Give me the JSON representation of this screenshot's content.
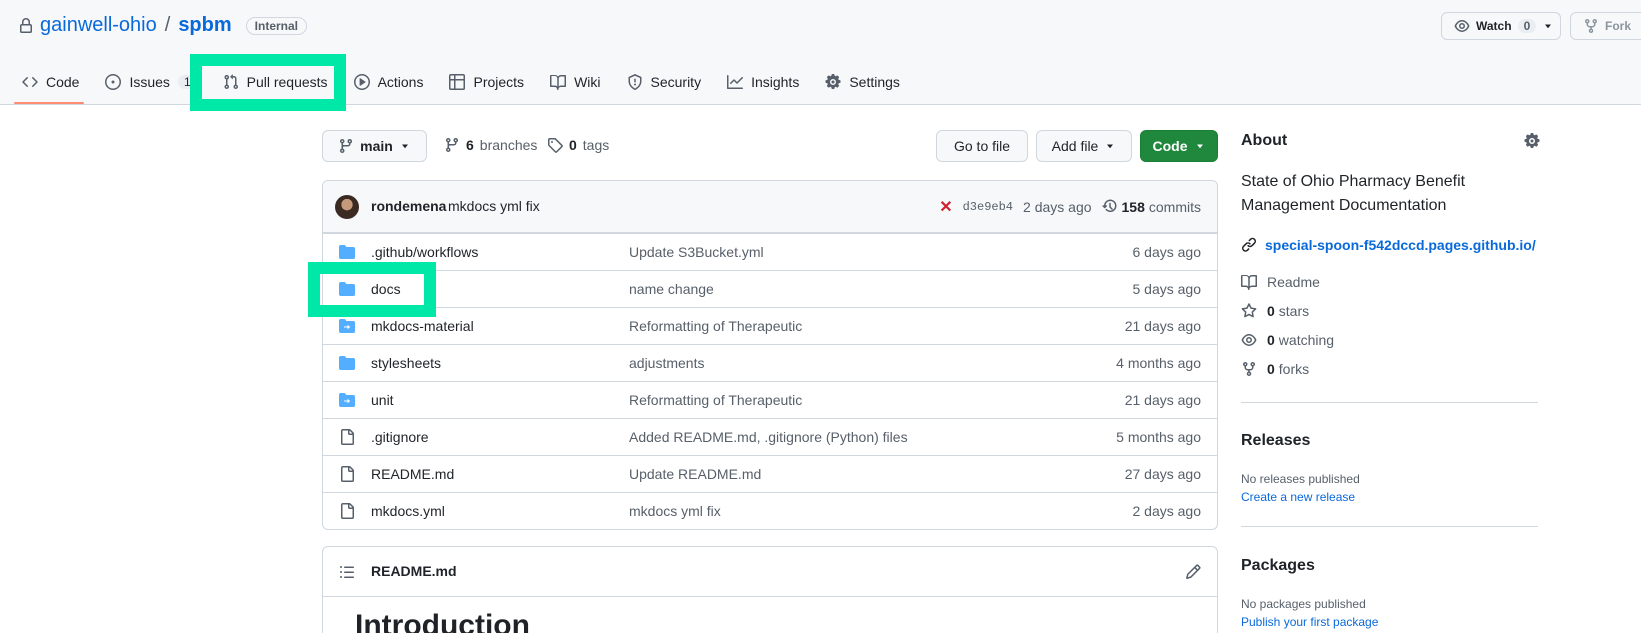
{
  "repo": {
    "owner": "gainwell-ohio",
    "separator": "/",
    "name": "spbm",
    "visibility": "Internal"
  },
  "header_actions": {
    "watch_label": "Watch",
    "watch_count": "0",
    "fork_label": "Fork"
  },
  "tabs": [
    {
      "label": "Code",
      "icon": "code-icon"
    },
    {
      "label": "Issues",
      "icon": "issue-icon",
      "count": "1"
    },
    {
      "label": "Pull requests",
      "icon": "pull-request-icon"
    },
    {
      "label": "Actions",
      "icon": "play-icon"
    },
    {
      "label": "Projects",
      "icon": "table-icon"
    },
    {
      "label": "Wiki",
      "icon": "book-icon"
    },
    {
      "label": "Security",
      "icon": "shield-icon"
    },
    {
      "label": "Insights",
      "icon": "graph-icon"
    },
    {
      "label": "Settings",
      "icon": "gear-icon"
    }
  ],
  "toolbar": {
    "branch": "main",
    "branches_count": "6",
    "branches_label": "branches",
    "tags_count": "0",
    "tags_label": "tags",
    "go_to_file": "Go to file",
    "add_file": "Add file",
    "code": "Code"
  },
  "latest_commit": {
    "author": "rondemena",
    "message": "mkdocs yml fix",
    "sha": "d3e9eb4",
    "age": "2 days ago",
    "commits_count": "158",
    "commits_label": "commits"
  },
  "files": [
    {
      "name": ".github/workflows",
      "type": "folder",
      "message": "Update S3Bucket.yml",
      "age": "6 days ago"
    },
    {
      "name": "docs",
      "type": "folder",
      "message": "name change",
      "age": "5 days ago"
    },
    {
      "name": "mkdocs-material",
      "type": "submodule",
      "message": "Reformatting of Therapeutic",
      "age": "21 days ago"
    },
    {
      "name": "stylesheets",
      "type": "folder",
      "message": "adjustments",
      "age": "4 months ago"
    },
    {
      "name": "unit",
      "type": "submodule",
      "message": "Reformatting of Therapeutic",
      "age": "21 days ago"
    },
    {
      "name": ".gitignore",
      "type": "file",
      "message": "Added README.md, .gitignore (Python) files",
      "age": "5 months ago"
    },
    {
      "name": "README.md",
      "type": "file",
      "message": "Update README.md",
      "age": "27 days ago"
    },
    {
      "name": "mkdocs.yml",
      "type": "file",
      "message": "mkdocs yml fix",
      "age": "2 days ago"
    }
  ],
  "readme": {
    "title": "README.md",
    "heading": "Introduction"
  },
  "about": {
    "heading": "About",
    "description": "State of Ohio Pharmacy Benefit Management Documentation",
    "website": "special-spoon-f542dccd.pages.github.io/",
    "readme_label": "Readme",
    "stars_count": "0",
    "stars_label": "stars",
    "watching_count": "0",
    "watching_label": "watching",
    "forks_count": "0",
    "forks_label": "forks"
  },
  "releases": {
    "heading": "Releases",
    "empty_text": "No releases published",
    "create_link": "Create a new release"
  },
  "packages": {
    "heading": "Packages",
    "empty_text": "No packages published",
    "publish_link": "Publish your first package"
  },
  "colors": {
    "link": "#0969da",
    "green_button": "#1f883d",
    "folder": "#54aeff",
    "highlight": "#00e8a8",
    "tab_underline": "#fd8c73"
  }
}
